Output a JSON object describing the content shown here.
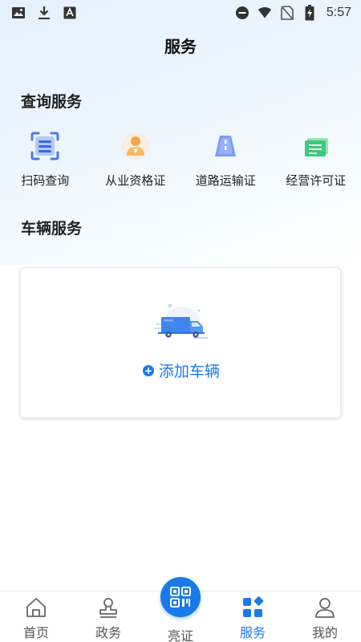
{
  "status_bar": {
    "time": "5:57",
    "left_icons": [
      "image-icon",
      "download-icon",
      "a-icon"
    ],
    "right_icons": [
      "dnd-icon",
      "wifi-icon",
      "no-sim-icon",
      "battery-charging-icon"
    ]
  },
  "header": {
    "title": "服务"
  },
  "query_section": {
    "title": "查询服务",
    "items": [
      {
        "label": "扫码查询",
        "icon": "scan-icon"
      },
      {
        "label": "从业资格证",
        "icon": "person-icon"
      },
      {
        "label": "道路运输证",
        "icon": "road-icon"
      },
      {
        "label": "经营许可证",
        "icon": "license-icon"
      }
    ]
  },
  "vehicle_section": {
    "title": "车辆服务",
    "add_label": "添加车辆",
    "plus_symbol": "+"
  },
  "tab_bar": {
    "tabs": [
      {
        "label": "首页",
        "icon": "home-icon"
      },
      {
        "label": "政务",
        "icon": "stamp-icon"
      },
      {
        "label": "亮证",
        "icon": "qrcode-icon"
      },
      {
        "label": "服务",
        "icon": "grid-icon"
      },
      {
        "label": "我的",
        "icon": "user-icon"
      }
    ],
    "active_index": 3
  },
  "colors": {
    "accent": "#1a7ae8"
  }
}
